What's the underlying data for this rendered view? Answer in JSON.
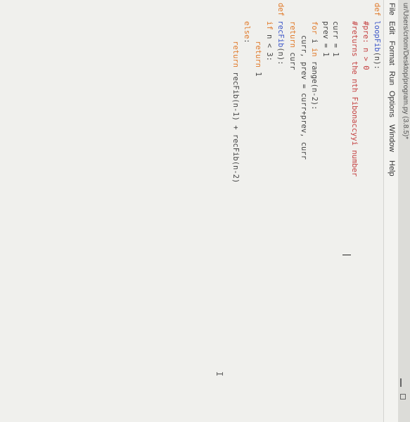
{
  "window": {
    "title": "ur/Users/crtom/Desktop/program.py (3.8.5)*"
  },
  "menu": {
    "items": [
      "File",
      "Edit",
      "Format",
      "Run",
      "Options",
      "Window",
      "Help"
    ]
  },
  "editor": {
    "line1_kw": "def",
    "line1_fn": "loopFib",
    "line1_rest": "(n):",
    "line2": "#pre: n > 0",
    "line3": "#returns the nth Fibonaccyyi number",
    "line4": "curr = 1",
    "line5": "prev = 1",
    "line6_kw1": "for",
    "line6_mid": " i ",
    "line6_kw2": "in",
    "line6_rest": " range(n-2):",
    "line7": "curr, prev = curr+prev, curr",
    "line8_kw": "return",
    "line8_rest": " curr",
    "line9_kw": "def",
    "line9_fn": "recFib",
    "line9_rest": "(n):",
    "line10_kw": "if",
    "line10_rest": " n < 3:",
    "line11_kw": "return",
    "line11_rest": " 1",
    "line12_kw": "else",
    "line12_rest": ":",
    "line13_kw": "return",
    "line13_rest": " recFib(n-1) + recFib(n-2)"
  },
  "icons": {
    "minimize": "minimize-icon",
    "maximize": "maximize-icon",
    "ibeam": "ibeam-cursor-icon"
  }
}
